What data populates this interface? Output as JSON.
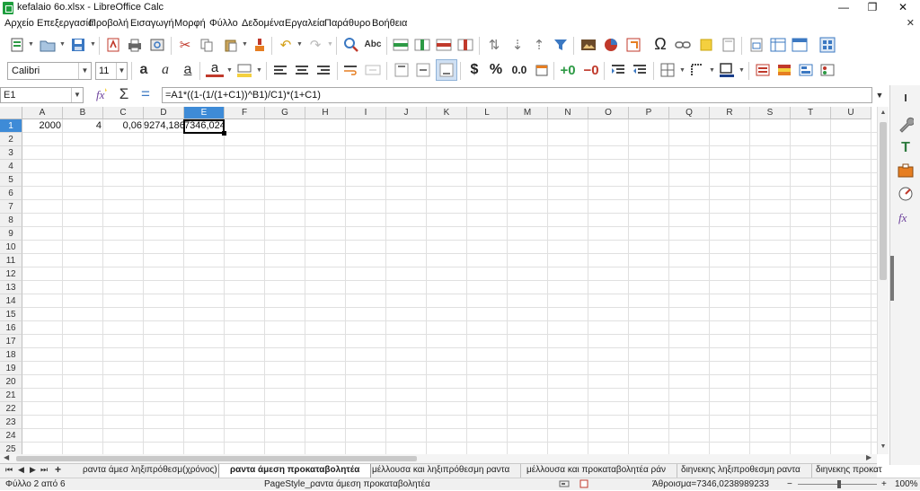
{
  "window": {
    "title": "kefalaio 6o.xlsx - LibreOffice Calc",
    "controls": [
      "—",
      "❐",
      "✕"
    ]
  },
  "menu": {
    "items": [
      "Αρχείο",
      "Επεξεργασία",
      "Προβολή",
      "Εισαγωγή",
      "Μορφή",
      "Φύλλο",
      "Δεδομένα",
      "Εργαλεία",
      "Παράθυρο",
      "Βοήθεια"
    ],
    "close_doc": "✕"
  },
  "toolbar2": {
    "font_name": "Calibri",
    "font_size": "11",
    "currency": "$",
    "percent": "%",
    "number": "0.0"
  },
  "formula_bar": {
    "name_box": "E1",
    "formula": "=A1*((1-(1/(1+C1))^B1)/C1)*(1+C1)"
  },
  "grid": {
    "columns": [
      "A",
      "B",
      "C",
      "D",
      "E",
      "F",
      "G",
      "H",
      "I",
      "J",
      "K",
      "L",
      "M",
      "N",
      "O",
      "P",
      "Q",
      "R",
      "S",
      "T",
      "U"
    ],
    "rows": [
      "1",
      "2",
      "3",
      "4",
      "5",
      "6",
      "7",
      "8",
      "9",
      "10",
      "11",
      "12",
      "13",
      "14",
      "15",
      "16",
      "17",
      "18",
      "19",
      "20",
      "21",
      "22",
      "23",
      "24",
      "25"
    ],
    "active_column": "E",
    "active_row": "1",
    "cells": {
      "A1": "2000",
      "B1": "4",
      "C1": "0,06",
      "D1": "9274,186",
      "E1": "7346,024"
    }
  },
  "sheet_tabs": {
    "nav": [
      "⏮",
      "◀",
      "▶",
      "⏭",
      "+"
    ],
    "tabs": [
      "ραντα άμεσ ληξιπρόθεσμ(χρόνος)",
      "ραντα άμεση προκαταβολητέα",
      "μέλλουσα και ληξιπρόθεσμη ραντα",
      "μέλλουσα και προκαταβολητέα ράν",
      "διηνεκης ληξιπροθεσμη ραντα",
      "διηνεκης προκατ"
    ],
    "active_index": 1
  },
  "status_bar": {
    "sheet_info": "Φύλλο 2 από 6",
    "page_style": "PageStyle_ραντα άμεση προκαταβολητέα",
    "sum": "Άθροισμα=7346,0238989233",
    "zoom": "100%",
    "zoom_minus": "−",
    "zoom_plus": "+"
  }
}
